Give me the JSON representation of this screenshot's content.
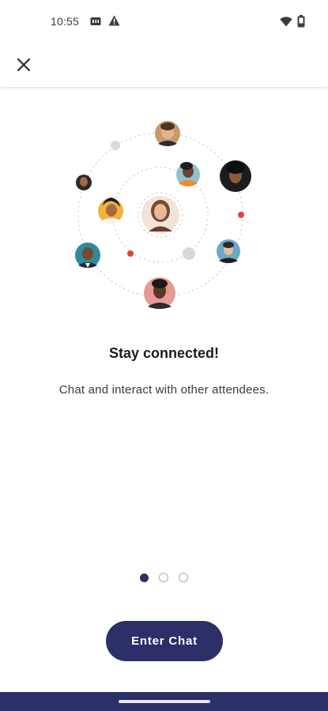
{
  "status_bar": {
    "time": "10:55",
    "icons": [
      "sim-card-icon",
      "warning-icon",
      "wifi-icon",
      "battery-icon"
    ]
  },
  "app_bar": {
    "close_icon": "close-icon"
  },
  "illustration": {
    "icon": "community-network-illustration",
    "colors": {
      "orbit": "#c9c9c9",
      "grey_dot": "#d9d9d9",
      "red_dot": "#e0433d"
    }
  },
  "onboarding": {
    "title": "Stay connected!",
    "subtitle": "Chat and interact with other attendees.",
    "page_count": 3,
    "current_page": 1
  },
  "actions": {
    "enter_chat_label": "Enter Chat"
  },
  "colors": {
    "accent": "#2d2f69",
    "background": "#ffffff"
  }
}
